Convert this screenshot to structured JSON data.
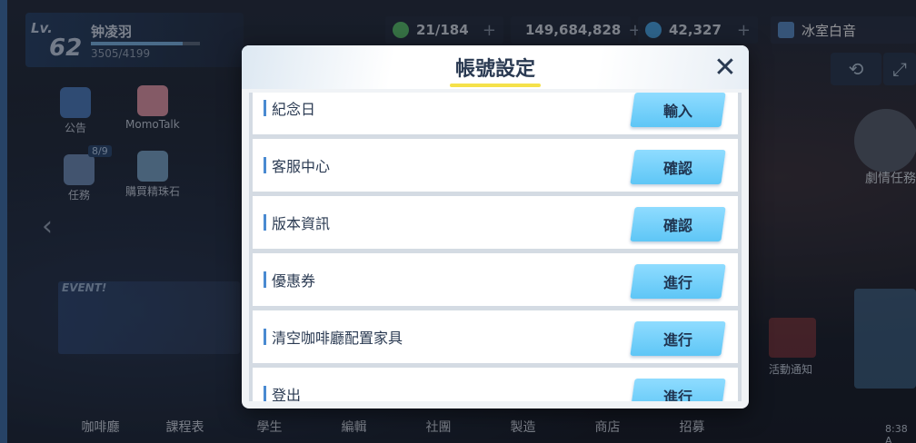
{
  "profile": {
    "lv_label": "Lv.",
    "level": "62",
    "name": "钟凌羽",
    "exp": "3505/4199"
  },
  "resources": {
    "ap": "21/184",
    "credits": "149,684,828",
    "gems": "42,327",
    "user_name": "冰室白音"
  },
  "side": {
    "notice": "公告",
    "momotalk": "MomoTalk",
    "tasks": "任務",
    "tasks_badge": "8/9",
    "shop": "購買精珠石"
  },
  "event_tag": "EVENT!",
  "right": {
    "label": "劇情任務",
    "notice_label": "活動通知",
    "time": "8:38 A"
  },
  "bottom_nav": [
    "咖啡廳",
    "課程表",
    "學生",
    "編輯",
    "社團",
    "製造",
    "商店",
    "招募"
  ],
  "modal": {
    "title": "帳號設定",
    "rows": [
      {
        "label": "紀念日",
        "button": "輸入"
      },
      {
        "label": "客服中心",
        "button": "確認"
      },
      {
        "label": "版本資訊",
        "button": "確認"
      },
      {
        "label": "優惠券",
        "button": "進行"
      },
      {
        "label": "清空咖啡廳配置家具",
        "button": "進行"
      },
      {
        "label": "登出",
        "button": "進行"
      }
    ]
  },
  "colors": {
    "accent": "#5ec6f6",
    "title_underline": "#f5e14a",
    "header_text": "#2a3a52"
  }
}
